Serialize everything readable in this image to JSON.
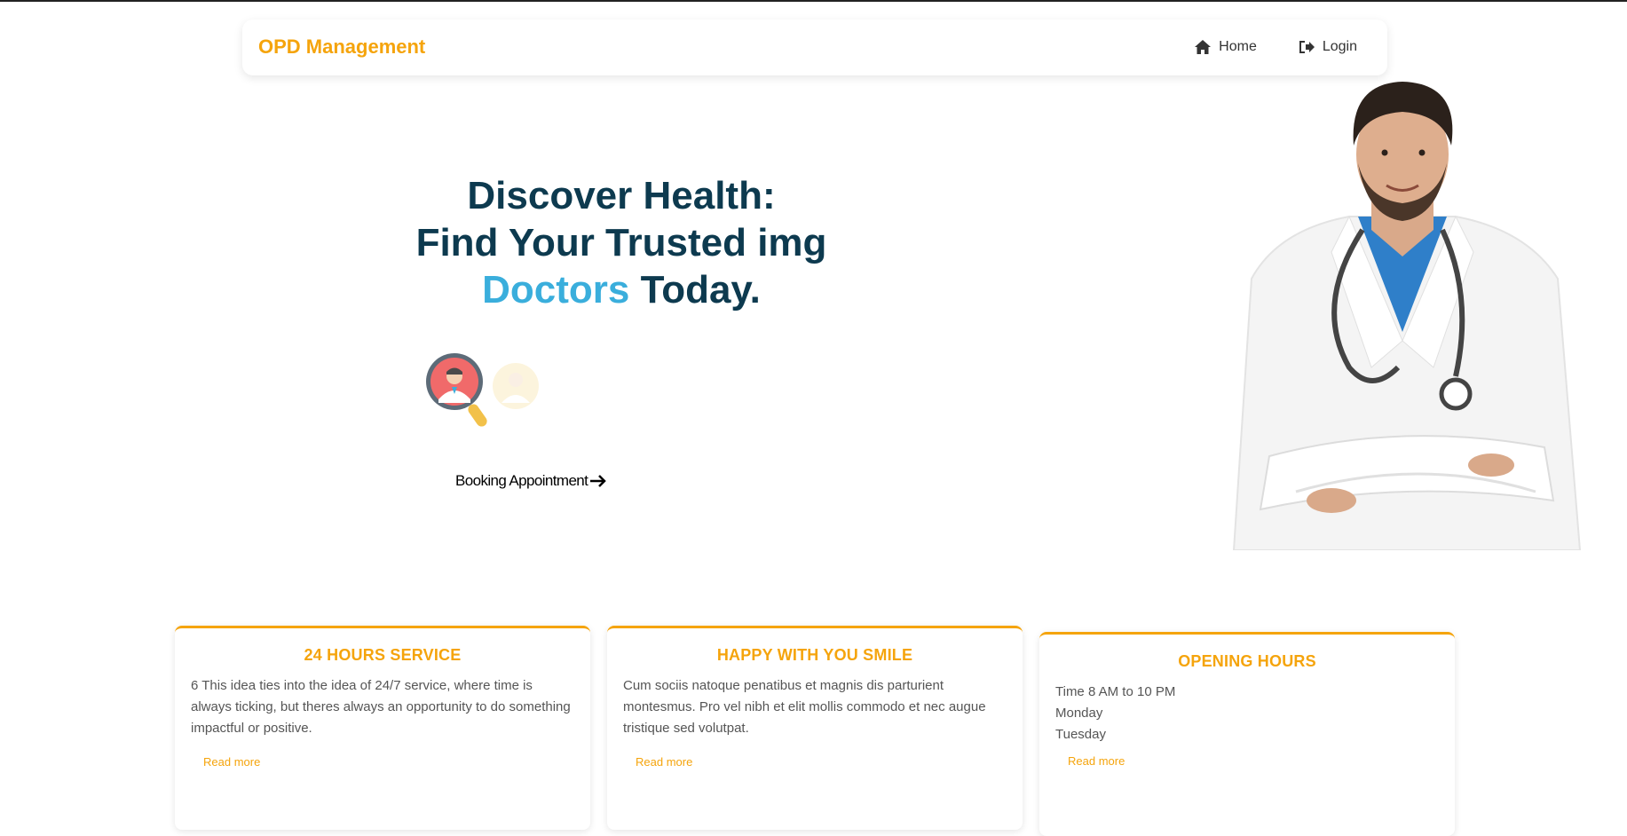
{
  "navbar": {
    "brand": "OPD Management",
    "links": [
      {
        "label": "Home",
        "icon": "home-icon"
      },
      {
        "label": "Login",
        "icon": "sign-in-icon"
      }
    ],
    "brand_color": "#f5a40c"
  },
  "hero": {
    "title_line1": "Discover Health:",
    "title_line2": "Find Your Trusted img",
    "title_accent": "Doctors",
    "title_end": " Today.",
    "title_color": "#0d3a4f",
    "accent_color": "#3aaedc",
    "booking_label": "Booking Appointment"
  },
  "cards": [
    {
      "title": "24 HOURS SERVICE",
      "text": "6 This idea ties into the idea of 24/7 service, where time is always ticking, but theres always an opportunity to do something impactful or positive.",
      "link": "Read more"
    },
    {
      "title": "HAPPY WITH YOU SMILE",
      "text": "Cum sociis natoque penatibus et magnis dis parturient montesmus. Pro vel nibh et elit mollis commodo et nec augue tristique sed volutpat.",
      "link": "Read more"
    },
    {
      "title": "OPENING HOURS",
      "lines": [
        "Time 8 AM to 10 PM",
        "Monday",
        "Tuesday"
      ],
      "link": "Read more"
    }
  ]
}
